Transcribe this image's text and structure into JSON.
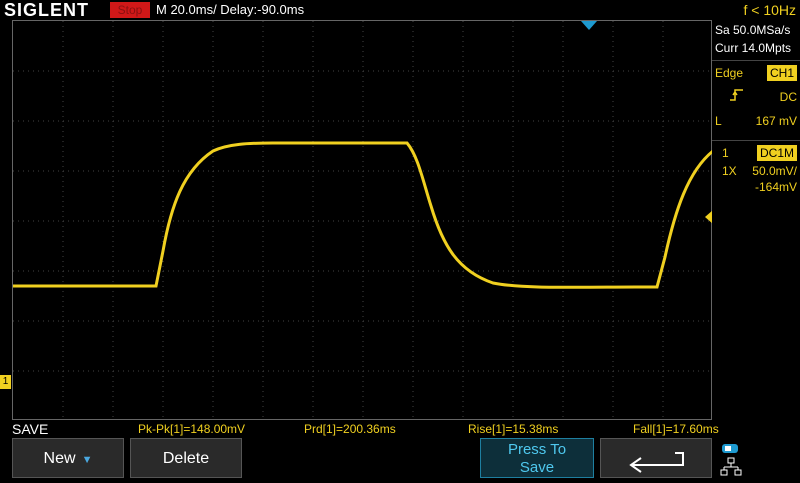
{
  "header": {
    "logo": "SIGLENT",
    "run_state": "Stop",
    "timebase": "M 20.0ms/ Delay:-90.0ms",
    "trigger_freq": "f < 10Hz"
  },
  "acquisition": {
    "sample_rate": "Sa 50.0MSa/s",
    "memory": "Curr 14.0Mpts"
  },
  "trigger": {
    "type_label": "Edge",
    "source": "CH1",
    "coupling": "DC",
    "level_label": "L",
    "level_value": "167 mV"
  },
  "channel1": {
    "number": "1",
    "coupling": "DC1M",
    "probe": "1X",
    "volts_per_div": "50.0mV/",
    "offset": "-164mV",
    "ground_marker": "1"
  },
  "save_bar": {
    "label": "SAVE",
    "measurements": {
      "pkpk": "Pk-Pk[1]=148.00mV",
      "period": "Prd[1]=200.36ms",
      "rise": "Rise[1]=15.38ms",
      "fall": "Fall[1]=17.60ms"
    }
  },
  "softkeys": {
    "new": "New",
    "delete": "Delete",
    "press_line1": "Press To",
    "press_line2": "Save"
  },
  "colors": {
    "trace": "#f0d020",
    "accent": "#1e9ad0",
    "stop": "#d01818"
  }
}
